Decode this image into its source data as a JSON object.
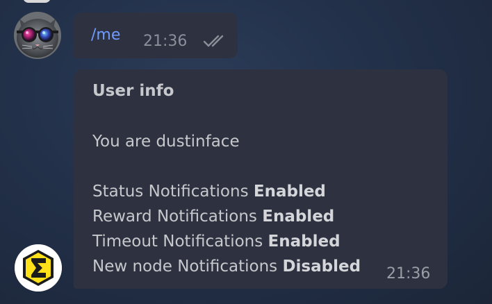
{
  "outgoing": {
    "text": "/me",
    "time": "21:36",
    "status_icon": "double-check-icon"
  },
  "incoming": {
    "title": "User info",
    "greeting": "You are dustinface",
    "notifications": [
      {
        "label": "Status Notifications",
        "state": "Enabled"
      },
      {
        "label": "Reward Notifications",
        "state": "Enabled"
      },
      {
        "label": "Timeout Notifications",
        "state": "Enabled"
      },
      {
        "label": "New node Notifications",
        "state": "Disabled"
      }
    ],
    "time": "21:36"
  },
  "avatars": {
    "user_icon": "cat-with-goggles-avatar",
    "bot_icon": "sigma-logo-avatar"
  },
  "colors": {
    "background": "#223049",
    "bubble": "#2e3240",
    "command_link": "#6f9bff",
    "text": "#c6c8cc",
    "time": "#8a8f99",
    "bot_logo": "#ffe11a"
  }
}
